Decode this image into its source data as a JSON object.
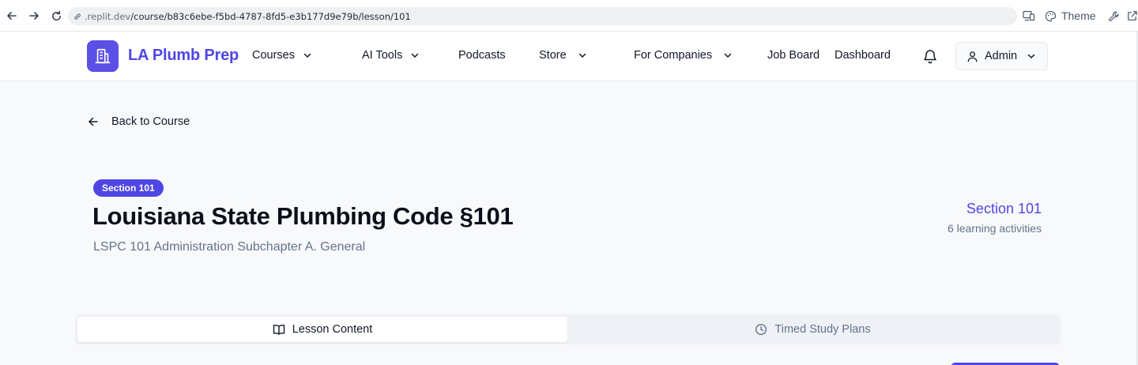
{
  "browser": {
    "url_host": ".replit.dev",
    "url_path": "/course/b83c6ebe-f5bd-4787-8fd5-e3b177d9e79b/lesson/101",
    "theme_label": "Theme"
  },
  "header": {
    "brand": "LA Plumb Prep",
    "nav": {
      "courses": "Courses",
      "ai_tools": "AI Tools",
      "podcasts": "Podcasts",
      "store": "Store",
      "for_companies": "For Companies",
      "job_board": "Job Board",
      "dashboard": "Dashboard"
    },
    "user_label": "Admin"
  },
  "main": {
    "back_label": "Back to Course",
    "badge": "Section 101",
    "title": "Louisiana State Plumbing Code §101",
    "subtitle": "LSPC 101 Administration Subchapter A. General",
    "section_label": "Section 101",
    "activities": "6 learning activities",
    "tabs": [
      {
        "label": "Lesson Content",
        "active": true
      },
      {
        "label": "Timed Study Plans",
        "active": false
      }
    ]
  },
  "colors": {
    "accent": "#4f46e5",
    "logo_bg": "#5b50e6",
    "page_bg": "#f8f9fb"
  },
  "icons": [
    "back-icon",
    "forward-icon",
    "reload-icon",
    "link-icon",
    "devices-icon",
    "palette-icon",
    "wrench-icon",
    "external-icon",
    "building-icon",
    "chevron-down-icon",
    "bell-icon",
    "user-icon",
    "arrow-left-icon",
    "book-open-icon",
    "clock-icon"
  ]
}
